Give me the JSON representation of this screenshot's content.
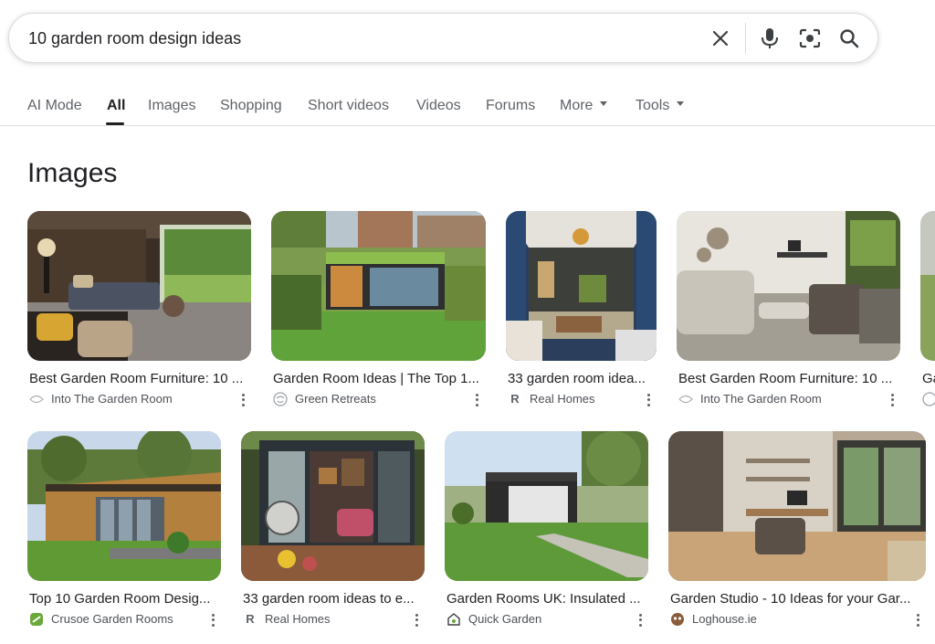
{
  "search": {
    "query": "10 garden room design ideas"
  },
  "icons": {
    "clear": "close-icon",
    "voice": "microphone-icon",
    "lens": "camera-lens-icon",
    "search": "search-icon"
  },
  "tabs": [
    {
      "label": "AI Mode"
    },
    {
      "label": "All"
    },
    {
      "label": "Images"
    },
    {
      "label": "Shopping"
    },
    {
      "label": "Short videos"
    },
    {
      "label": "Videos"
    },
    {
      "label": "Forums"
    },
    {
      "label": "More"
    },
    {
      "label": "Tools"
    }
  ],
  "active_tab": "All",
  "section": {
    "title": "Images"
  },
  "row1": [
    {
      "title": "Best Garden Room Furniture: 10 ...",
      "source": "Into The Garden Room",
      "source_icon": "leaf-logo-icon"
    },
    {
      "title": "Garden Room Ideas | The Top 1...",
      "source": "Green Retreats",
      "source_icon": "green-retreats-logo-icon"
    },
    {
      "title": "33 garden room idea...",
      "source": "Real Homes",
      "source_icon": "real-homes-logo-icon"
    },
    {
      "title": "Best Garden Room Furniture: 10 ...",
      "source": "Into The Garden Room",
      "source_icon": "leaf-logo-icon"
    },
    {
      "title": "Ga",
      "source": "",
      "source_icon": "green-retreats-logo-icon"
    }
  ],
  "row2": [
    {
      "title": "Top 10 Garden Room Desig...",
      "source": "Crusoe Garden Rooms",
      "source_icon": "crusoe-logo-icon"
    },
    {
      "title": "33 garden room ideas to e...",
      "source": "Real Homes",
      "source_icon": "real-homes-logo-icon"
    },
    {
      "title": "Garden Rooms UK: Insulated ...",
      "source": "Quick Garden",
      "source_icon": "quick-garden-logo-icon"
    },
    {
      "title": "Garden Studio - 10 Ideas for your Gar...",
      "source": "Loghouse.ie",
      "source_icon": "loghouse-logo-icon"
    }
  ],
  "colors": {
    "accent": "#202124",
    "muted": "#5f6368",
    "border": "#dadce0"
  }
}
